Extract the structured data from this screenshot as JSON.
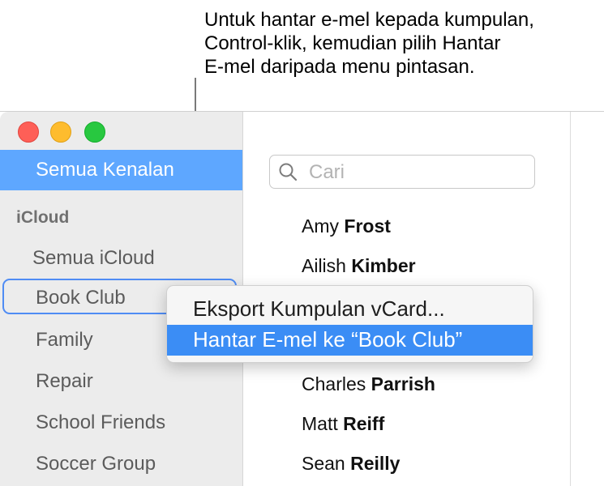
{
  "callout": {
    "line1": "Untuk hantar e-mel kepada kumpulan,",
    "line2": "Control-klik, kemudian pilih Hantar",
    "line3": "E-mel daripada menu pintasan."
  },
  "sidebar": {
    "selected": "Semua Kenalan",
    "section_header": "iCloud",
    "items": [
      "Semua iCloud",
      "Book Club",
      "Family",
      "Repair",
      "School Friends",
      "Soccer Group"
    ]
  },
  "search": {
    "placeholder": "Cari"
  },
  "contacts": [
    {
      "first": "Amy",
      "last": "Frost"
    },
    {
      "first": "Ailish",
      "last": "Kimber"
    },
    {
      "first": "Charles",
      "last": "Parrish"
    },
    {
      "first": "Matt",
      "last": "Reiff"
    },
    {
      "first": "Sean",
      "last": "Reilly"
    }
  ],
  "context_menu": {
    "export": "Eksport Kumpulan vCard...",
    "send": "Hantar E-mel ke “Book Club”"
  },
  "colors": {
    "selection": "#5ea7ff",
    "menu_highlight": "#3b8df5",
    "focus_ring": "#4f8cf4"
  }
}
